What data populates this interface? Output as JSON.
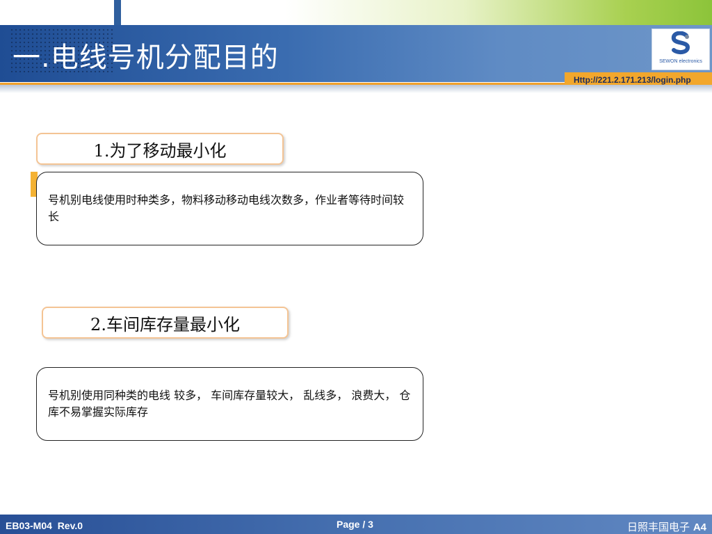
{
  "header": {
    "title": "一.电线号机分配目的",
    "url": "Http://221.2.171.213/login.php",
    "logo_text": "SEWON electronics",
    "logo_icon": "sewon-logo-icon"
  },
  "sections": [
    {
      "heading": "1.为了移动最小化",
      "body": "号机别电线使用时种类多，物料移动移动电线次数多，作业者等待时间较长"
    },
    {
      "heading": "2.车间库存量最小化",
      "body": "号机别使用同种类的电线 较多， 车间库存量较大， 乱线多， 浪费大， 仓库不易掌握实际库存"
    }
  ],
  "footer": {
    "doc_code": "EB03-M04  Rev.0",
    "page": "Page / 3",
    "company": "日照丰国电子",
    "company_suffix": "A4"
  },
  "colors": {
    "title_band": "#3a6cb0",
    "accent_orange": "#f1a12a",
    "heading_border": "#f4c494",
    "footer": "#4670b0"
  }
}
